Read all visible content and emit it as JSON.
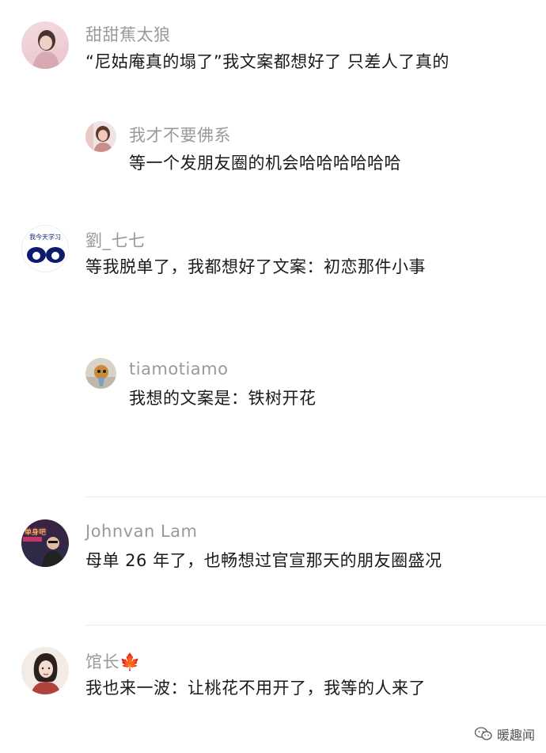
{
  "comments": [
    {
      "user": "甜甜蕉太狼",
      "text": "“尼姑庵真的塌了”我文案都想好了 只差人了真的",
      "reply": {
        "user": "我才不要佛系",
        "text": "等一个发朋友圈的机会哈哈哈哈哈哈"
      }
    },
    {
      "user": "劉_七七",
      "avatar_text": "我今天学习",
      "text": "等我脱单了，我都想好了文案：初恋那件小事",
      "reply": {
        "user": "tiamotiamo",
        "text": "我想的文案是：铁树开花"
      }
    },
    {
      "user": "Johnvan Lam",
      "avatar_text": "单身吧",
      "text": "母单 26 年了，也畅想过官宣那天的朋友圈盛况"
    },
    {
      "user": "馆长🍁",
      "text": "我也来一波：让桃花不用开了，我等的人来了"
    }
  ],
  "watermark": "暖趣闻",
  "colors": {
    "name": "#9a9a9a",
    "text": "#1a1a1a",
    "divider": "#ececec"
  }
}
